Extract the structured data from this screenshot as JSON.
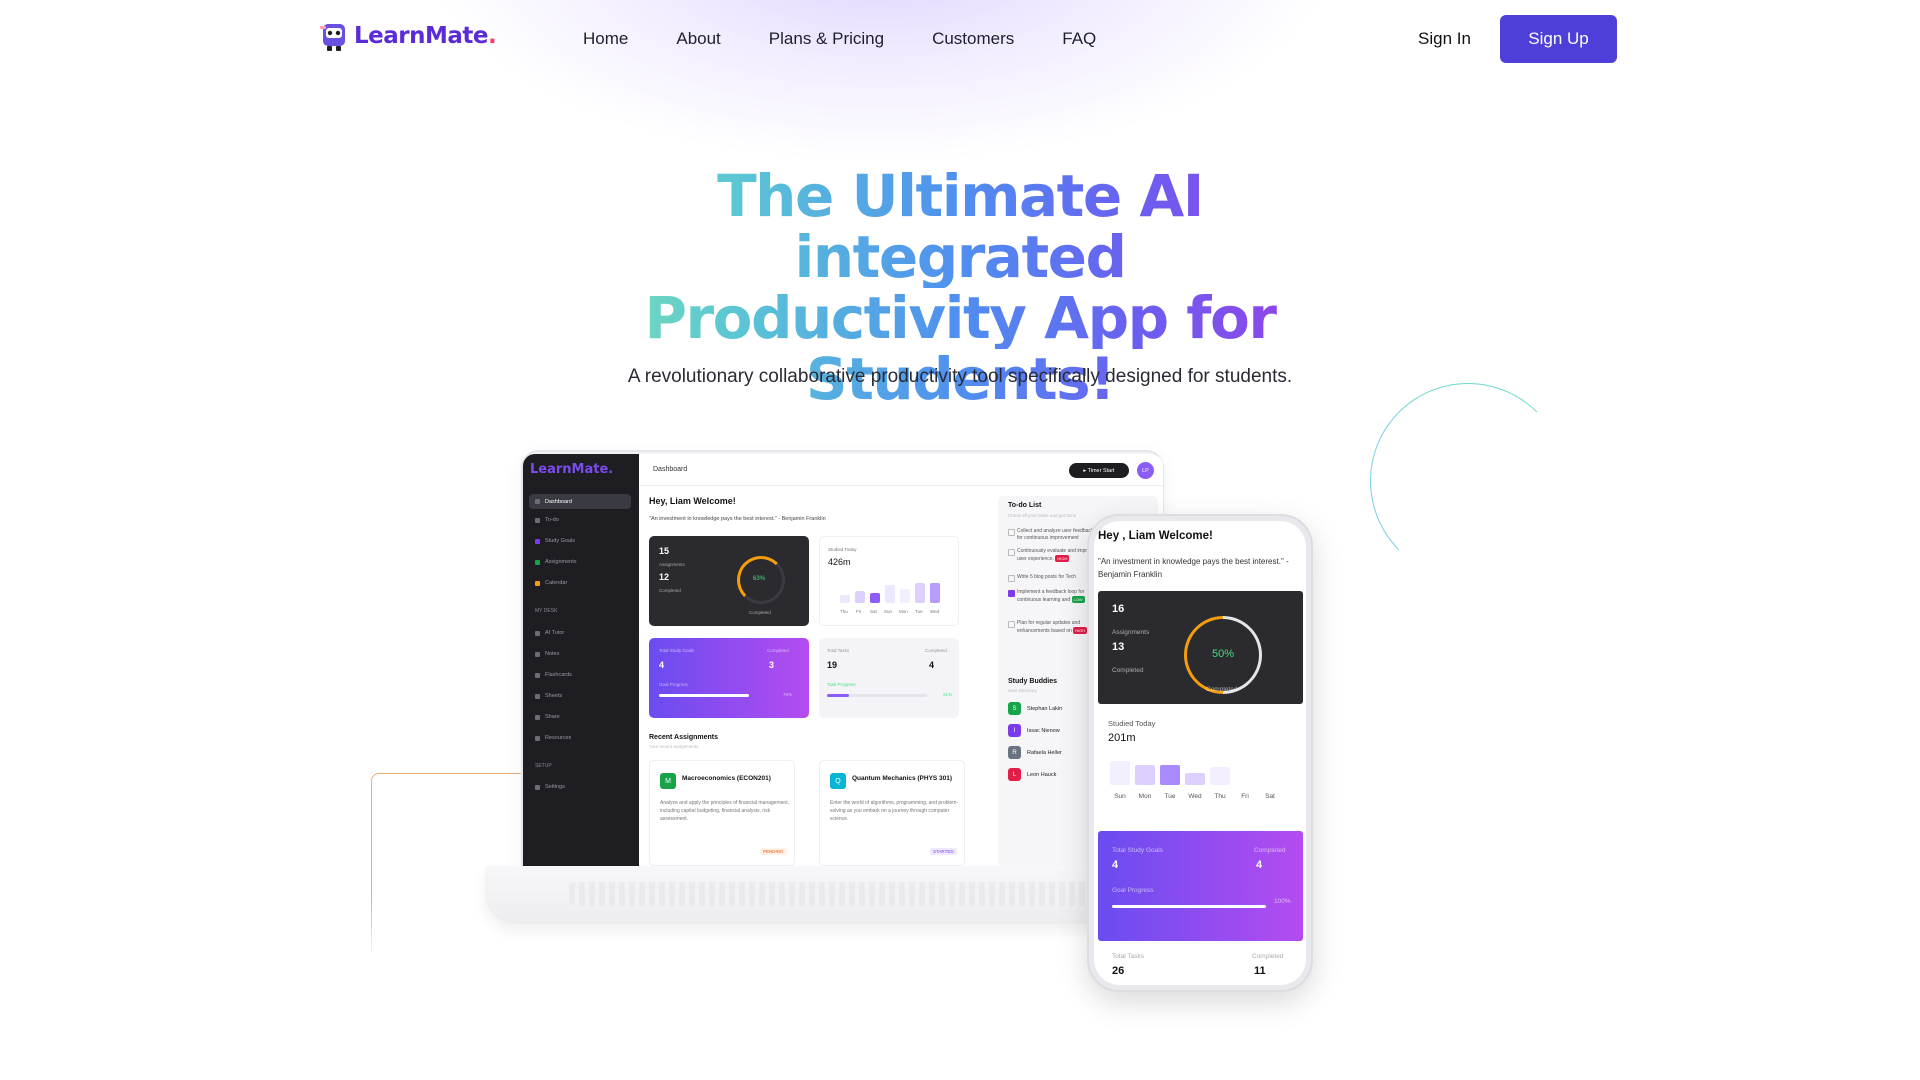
{
  "brand": {
    "name": "LearnMate",
    "dot": ".",
    "accent": "#4f3fd9"
  },
  "nav": {
    "links": [
      "Home",
      "About",
      "Plans & Pricing",
      "Customers",
      "FAQ"
    ],
    "signin": "Sign In",
    "signup": "Sign Up"
  },
  "hero": {
    "title_lines": [
      "The Ultimate AI integrated",
      "Productivity App for",
      "Students!"
    ],
    "subtitle": "A revolutionary collaborative productivity tool specifically designed for students."
  },
  "laptop": {
    "logo": "LearnMate.",
    "sidebar": {
      "items": [
        "Dashboard",
        "To-do",
        "Study Goals",
        "Assignments",
        "Calendar"
      ],
      "my_desk_head": "MY DESK",
      "desk_items": [
        "AI Tutor",
        "Notes",
        "Flashcards",
        "Sheets",
        "Share",
        "Resources"
      ],
      "setup_head": "SETUP",
      "setup_items": [
        "Settings"
      ]
    },
    "topbar": {
      "title": "Dashboard",
      "timer": "▸ Timer Start",
      "avatar": "LP"
    },
    "welcome": "Hey, Liam Welcome!",
    "quote": "\"An investment in knowledge pays the best interest.\" - Benjamin Franklin",
    "assign_card": {
      "total": "15",
      "label": "Assignments",
      "completed": "12",
      "completed_label": "Completed",
      "percent": "63%",
      "ring_caption": "Completed"
    },
    "studied": {
      "label": "Studied Today",
      "value": "426m",
      "days": [
        "Thu",
        "Fri",
        "Sat",
        "Sun",
        "Mon",
        "Tue",
        "Wed"
      ]
    },
    "goals": {
      "label": "Total Study Goals",
      "value": "4",
      "completed_label": "Completed",
      "completed": "3",
      "progress_label": "Goal Progress",
      "percent": "75%"
    },
    "tasks": {
      "label": "Total Tasks",
      "value": "19",
      "completed_label": "Completed",
      "completed": "4",
      "progress_label": "Task Progress",
      "percent": "21%"
    },
    "recent": {
      "title": "Recent Assignments",
      "subtitle": "Your recent assignments"
    },
    "assignments": [
      {
        "icon": "M",
        "title": "Macroeconomics (ECON201)",
        "desc": "Analyze and apply the principles of financial management, including capital budgeting, financial analysis, risk assessment.",
        "tag": "PENDING"
      },
      {
        "icon": "Q",
        "title": "Quantum Mechanics (PHYS 301)",
        "desc": "Enter the world of algorithms, programming, and problem-solving as you embark on a journey through computer science.",
        "tag": "STARTED"
      }
    ],
    "todo": {
      "title": "To-do List",
      "subtitle": "Check off your tasks and get done",
      "items": [
        {
          "text": "Collect and analyze user feedback for continuous improvement",
          "badge": ""
        },
        {
          "text": "Continuously evaluate and improve user experience.",
          "badge": "HIGH"
        },
        {
          "text": "Write 5 blog posts for Tech",
          "badge": ""
        },
        {
          "text": "Implement a feedback loop for continuous learning and",
          "badge": "LOW"
        },
        {
          "text": "Plan for regular updates and enhancements based on",
          "badge": "HIGH"
        }
      ]
    },
    "buddies": {
      "title": "Study Buddies",
      "subtitle": "User Directory",
      "people": [
        {
          "initial": "S",
          "name": "Stephan Lakin",
          "color": "#16a34a"
        },
        {
          "initial": "I",
          "name": "Issac Nienow",
          "color": "#7c3aed"
        },
        {
          "initial": "R",
          "name": "Rafaela Heller",
          "color": "#6b7280"
        },
        {
          "initial": "L",
          "name": "Leon Hauck",
          "color": "#e11d48"
        }
      ]
    }
  },
  "phone": {
    "welcome": "Hey , Liam Welcome!",
    "quote": "\"An investment in knowledge pays the best interest.\" - Benjamin Franklin",
    "assign_card": {
      "total": "16",
      "label": "Assignments",
      "completed": "13",
      "completed_label": "Completed",
      "percent": "50%",
      "ring_caption": "Completed"
    },
    "studied": {
      "label": "Studied Today",
      "value": "201m",
      "days": [
        "Sun",
        "Mon",
        "Tue",
        "Wed",
        "Thu",
        "Fri",
        "Sat"
      ]
    },
    "goals": {
      "label": "Total Study Goals",
      "value": "4",
      "completed_label": "Completed",
      "completed": "4",
      "progress_label": "Goal Progress",
      "percent": "100%"
    },
    "tasks": {
      "label": "Total Tasks",
      "value": "26",
      "completed_label": "Completed",
      "completed": "11"
    }
  }
}
